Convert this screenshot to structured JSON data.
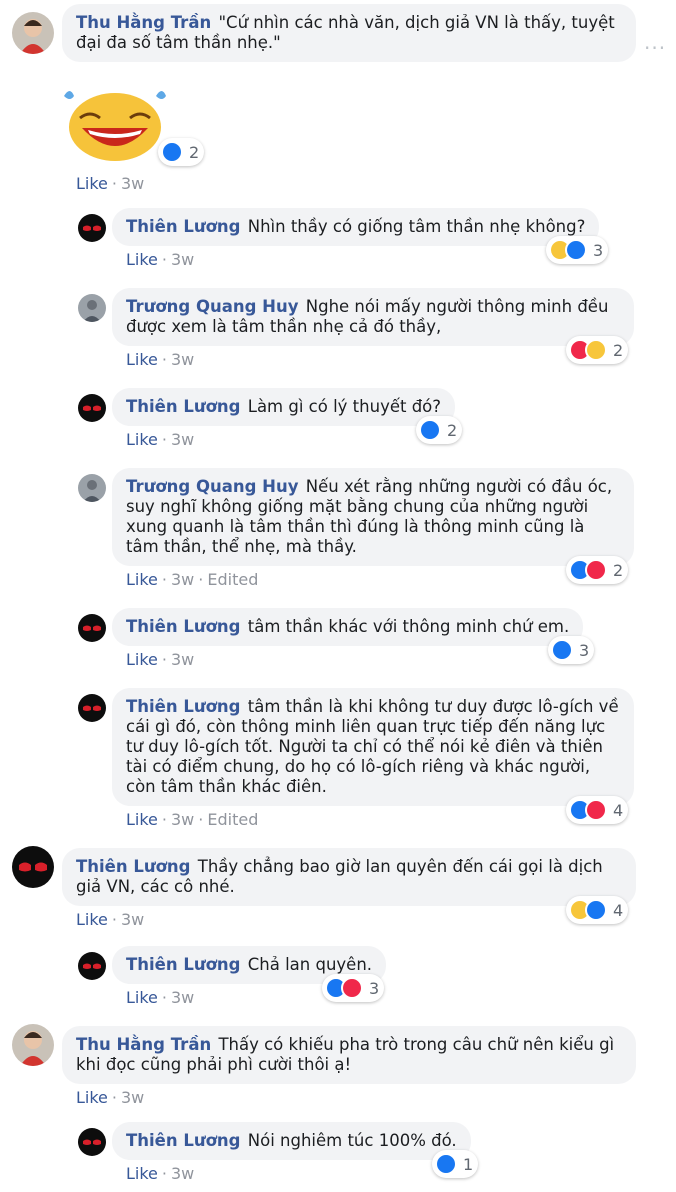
{
  "comments": [
    {
      "id": "c1",
      "kind": "top",
      "author": "Thu Hằng Trần",
      "text": "\"Cứ nhìn các nhà văn, dịch giả VN là thấy, tuyệt đại đa số tâm thần nhẹ.\"",
      "like": "Like",
      "time": "3w",
      "edited": null,
      "reactions": {
        "types": [
          "like"
        ],
        "count": "2"
      },
      "sticker": "laughing-emoji-sticker"
    },
    {
      "id": "r1",
      "kind": "reply",
      "author": "Thiên Lương",
      "text": "Nhìn thầy có giống tâm thần nhẹ không?",
      "like": "Like",
      "time": "3w",
      "edited": null,
      "reactions": {
        "types": [
          "haha",
          "like"
        ],
        "count": "3"
      }
    },
    {
      "id": "r2",
      "kind": "reply",
      "author": "Trương Quang Huy",
      "text": "Nghe nói mấy người thông minh đều được xem là tâm thần nhẹ cả đó thầy,",
      "like": "Like",
      "time": "3w",
      "edited": null,
      "reactions": {
        "types": [
          "love",
          "haha"
        ],
        "count": "2"
      }
    },
    {
      "id": "r3",
      "kind": "reply",
      "author": "Thiên Lương",
      "text": "Làm gì có lý thuyết đó?",
      "like": "Like",
      "time": "3w",
      "edited": null,
      "reactions": {
        "types": [
          "like"
        ],
        "count": "2"
      }
    },
    {
      "id": "r4",
      "kind": "reply",
      "author": "Trương Quang Huy",
      "text": "Nếu xét rằng những người có đầu óc, suy nghĩ không giống mặt bằng chung của những người xung quanh là tâm thần thì đúng là thông minh cũng là tâm thần, thể nhẹ, mà thầy.",
      "like": "Like",
      "time": "3w",
      "edited": "Edited",
      "reactions": {
        "types": [
          "like",
          "love"
        ],
        "count": "2"
      }
    },
    {
      "id": "r5",
      "kind": "reply",
      "author": "Thiên Lương",
      "text": "tâm thần khác với thông minh chứ em.",
      "like": "Like",
      "time": "3w",
      "edited": null,
      "reactions": {
        "types": [
          "like"
        ],
        "count": "3"
      }
    },
    {
      "id": "r6",
      "kind": "reply",
      "author": "Thiên Lương",
      "text": "tâm thần là khi không tư duy được lô-gích về cái gì đó, còn thông minh liên quan trực tiếp đến năng lực tư duy lô-gích tốt. Người ta chỉ có thể nói kẻ điên và thiên tài có điểm chung, do họ có lô-gích riêng và khác người, còn tâm thần khác điên.",
      "like": "Like",
      "time": "3w",
      "edited": "Edited",
      "reactions": {
        "types": [
          "like",
          "love"
        ],
        "count": "4"
      }
    },
    {
      "id": "c2",
      "kind": "top",
      "author": "Thiên Lương",
      "text": "Thầy chẳng bao giờ lan quyên đến cái gọi là dịch giả VN, các cô nhé.",
      "like": "Like",
      "time": "3w",
      "edited": null,
      "reactions": {
        "types": [
          "haha",
          "like"
        ],
        "count": "4"
      }
    },
    {
      "id": "r7",
      "kind": "reply",
      "author": "Thiên Lương",
      "text": "Chả lan quyên.",
      "like": "Like",
      "time": "3w",
      "edited": null,
      "reactions": {
        "types": [
          "like",
          "love"
        ],
        "count": "3"
      }
    },
    {
      "id": "c3",
      "kind": "top",
      "author": "Thu Hằng Trần",
      "text": "Thấy có khiếu pha trò trong câu chữ nên kiểu gì khi đọc cũng phải phì cười thôi ạ!",
      "like": "Like",
      "time": "3w",
      "edited": null,
      "reactions": null
    },
    {
      "id": "r8",
      "kind": "reply",
      "author": "Thiên Lương",
      "text": "Nói nghiêm túc 100% đó.",
      "like": "Like",
      "time": "3w",
      "edited": null,
      "reactions": {
        "types": [
          "like"
        ],
        "count": "1"
      }
    }
  ],
  "more_options": "...",
  "colors": {
    "name": "#385898",
    "bubble": "#f2f3f5",
    "meta": "#90949c",
    "like": "#1877f2",
    "love": "#f0284a",
    "haha": "#f7c63b"
  }
}
